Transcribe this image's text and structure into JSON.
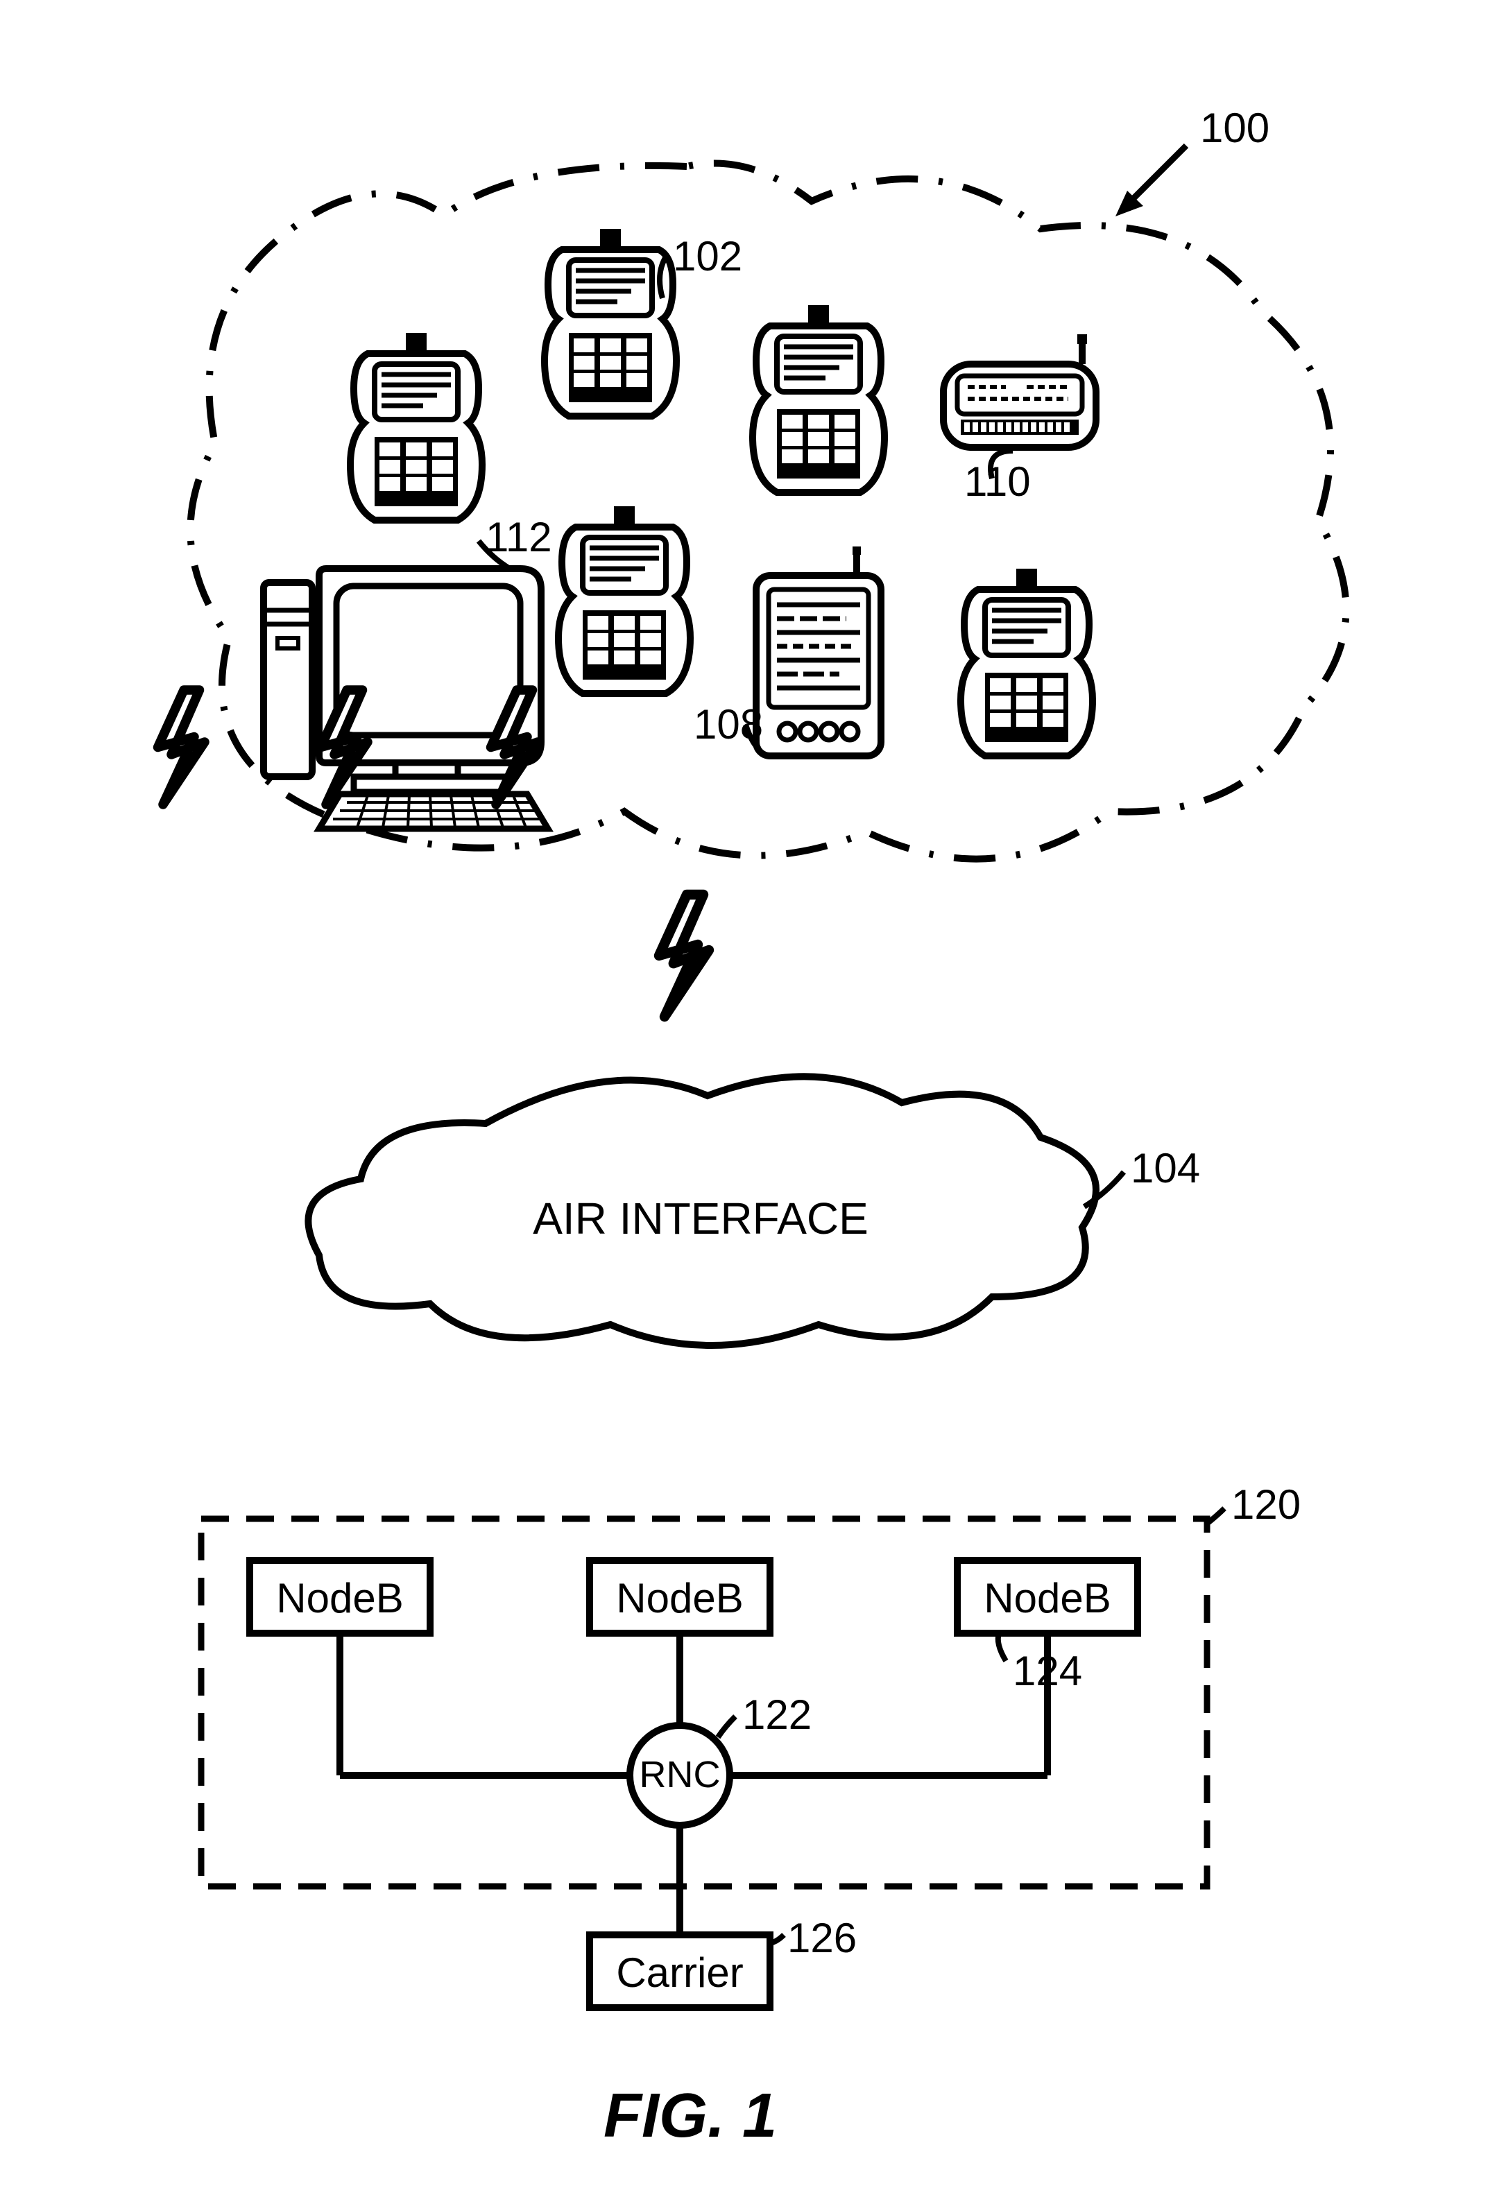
{
  "figure_label": "FIG. 1",
  "refs": {
    "system": "100",
    "phone_top": "102",
    "air_interface_cloud": "104",
    "pda": "108",
    "pager": "110",
    "computer": "112",
    "dashed_box": "120",
    "rnc": "122",
    "nodeb_right": "124",
    "carrier": "126"
  },
  "labels": {
    "air_interface": "AIR INTERFACE",
    "nodeb": "NodeB",
    "rnc": "RNC",
    "carrier": "Carrier"
  }
}
